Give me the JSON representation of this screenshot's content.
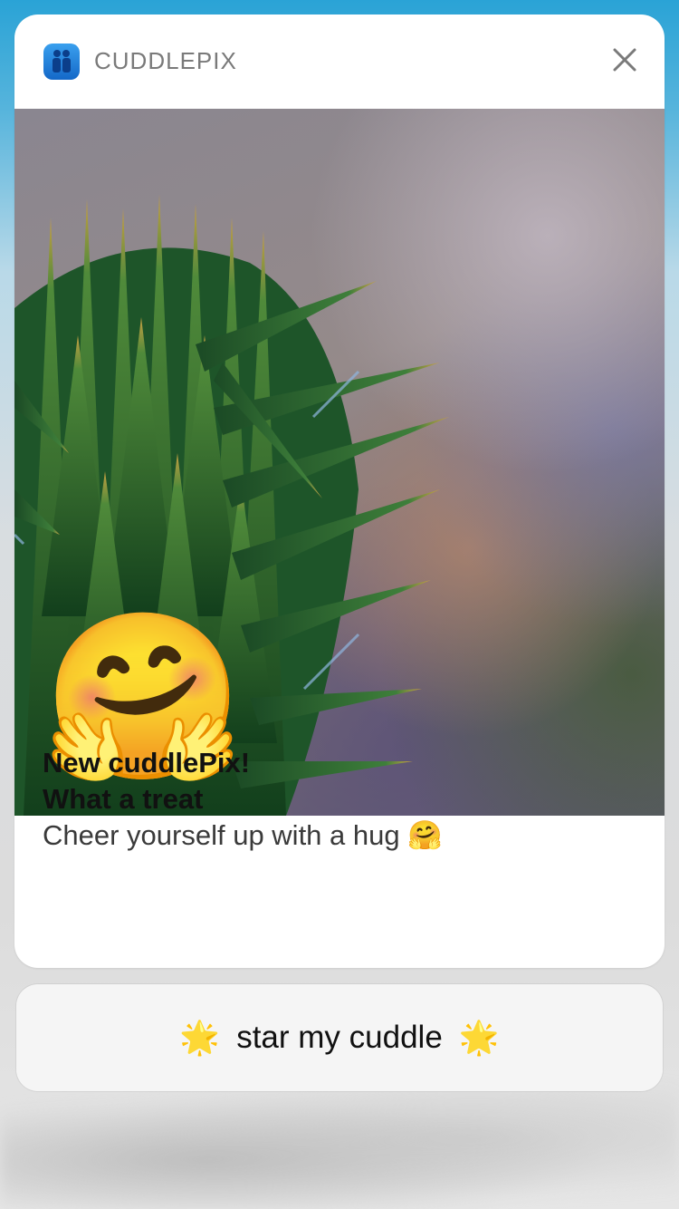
{
  "notification": {
    "app_name": "CUDDLEPIX",
    "app_icon": "person-pair-icon",
    "close_icon": "close-icon",
    "image": {
      "subject": "spiky green plant with hugging face emoji",
      "emoji": "🤗"
    },
    "title_line1": "New cuddlePix!",
    "title_line2": "What a treat",
    "body": "Cheer yourself up with a hug 🤗"
  },
  "action": {
    "label": "star my cuddle",
    "left_icon": "🌟",
    "right_icon": "🌟"
  },
  "colors": {
    "background_top": "#2aa3d6",
    "card": "#ffffff",
    "app_icon_blue": "#1468c8",
    "app_name_gray": "#7a7a7a"
  }
}
